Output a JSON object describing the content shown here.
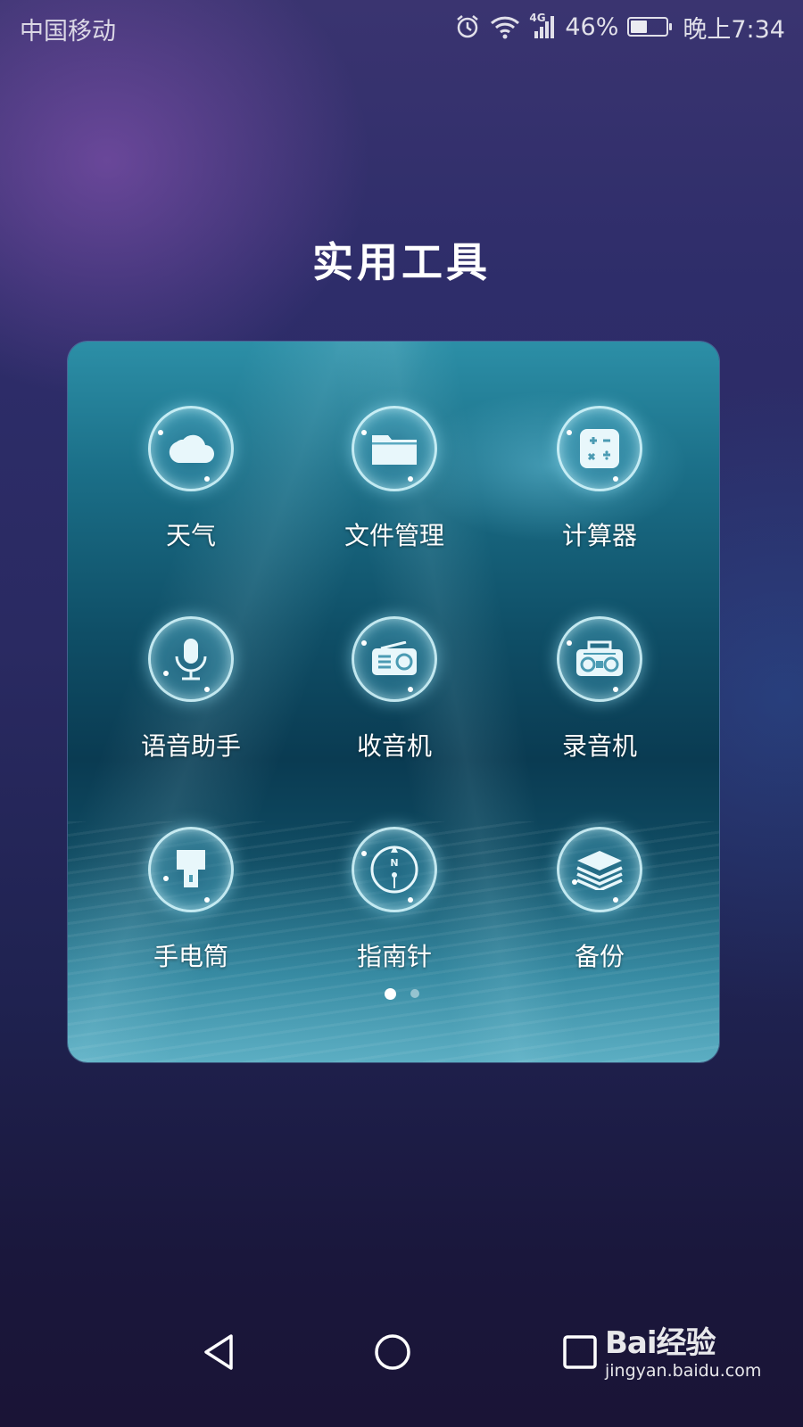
{
  "status_bar": {
    "carrier": "中国移动",
    "network": "4G",
    "battery_percent": "46%",
    "battery_level": 0.46,
    "time": "晚上7:34",
    "icons": [
      "alarm-icon",
      "wifi-icon",
      "signal-icon",
      "battery-icon"
    ]
  },
  "folder": {
    "title": "实用工具",
    "apps": [
      {
        "label": "天气",
        "icon": "weather-cloud-icon"
      },
      {
        "label": "文件管理",
        "icon": "folder-icon"
      },
      {
        "label": "计算器",
        "icon": "calculator-icon"
      },
      {
        "label": "语音助手",
        "icon": "microphone-icon"
      },
      {
        "label": "收音机",
        "icon": "radio-icon"
      },
      {
        "label": "录音机",
        "icon": "recorder-icon"
      },
      {
        "label": "手电筒",
        "icon": "flashlight-icon"
      },
      {
        "label": "指南针",
        "icon": "compass-icon"
      },
      {
        "label": "备份",
        "icon": "backup-layers-icon"
      }
    ],
    "page_indicator": {
      "pages": 2,
      "current": 1
    }
  },
  "nav_bar": {
    "buttons": [
      "back-icon",
      "home-icon",
      "recents-icon"
    ]
  },
  "watermark": {
    "logo": "Bai经验",
    "url": "jingyan.baidu.com"
  },
  "colors": {
    "accent": "#ffffff",
    "panel_water": "#0f4f67",
    "bubble_glow": "#a0ebff"
  }
}
